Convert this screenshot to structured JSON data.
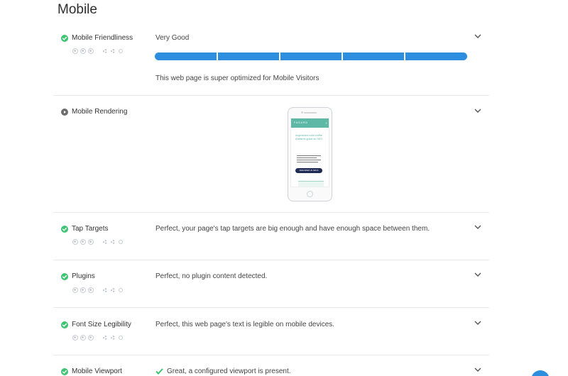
{
  "section": {
    "title": "Mobile"
  },
  "colors": {
    "pass": "#3fc474",
    "neutral": "#6d6d6d",
    "progress": "#2d8ee0"
  },
  "icons": {
    "status": "check-circle-icon",
    "info": "play-circle-icon",
    "expand": "chevron-down-icon",
    "tools": "device-icons"
  },
  "rows": [
    {
      "title": "Mobile Friendliness",
      "status": "pass",
      "rating": "Very Good",
      "progress_segments": 5,
      "progress_filled": 5,
      "description": "This web page is super optimized for Mobile Visitors"
    },
    {
      "title": "Mobile Rendering",
      "status": "info",
      "preview": {
        "brand": "FASARD",
        "menu": "≡",
        "heading": "Augmentez votre chiffre d'affaires grâce au SEO",
        "button": "DEMANDER UN DEVIS"
      }
    },
    {
      "title": "Tap Targets",
      "status": "pass",
      "description": "Perfect, your page's tap targets are big enough and have enough space between them."
    },
    {
      "title": "Plugins",
      "status": "pass",
      "description": "Perfect, no plugin content detected."
    },
    {
      "title": "Font Size Legibility",
      "status": "pass",
      "description": "Perfect, this web page's text is legible on mobile devices."
    },
    {
      "title": "Mobile Viewport",
      "status": "pass",
      "description": "Great, a configured viewport is present."
    }
  ]
}
